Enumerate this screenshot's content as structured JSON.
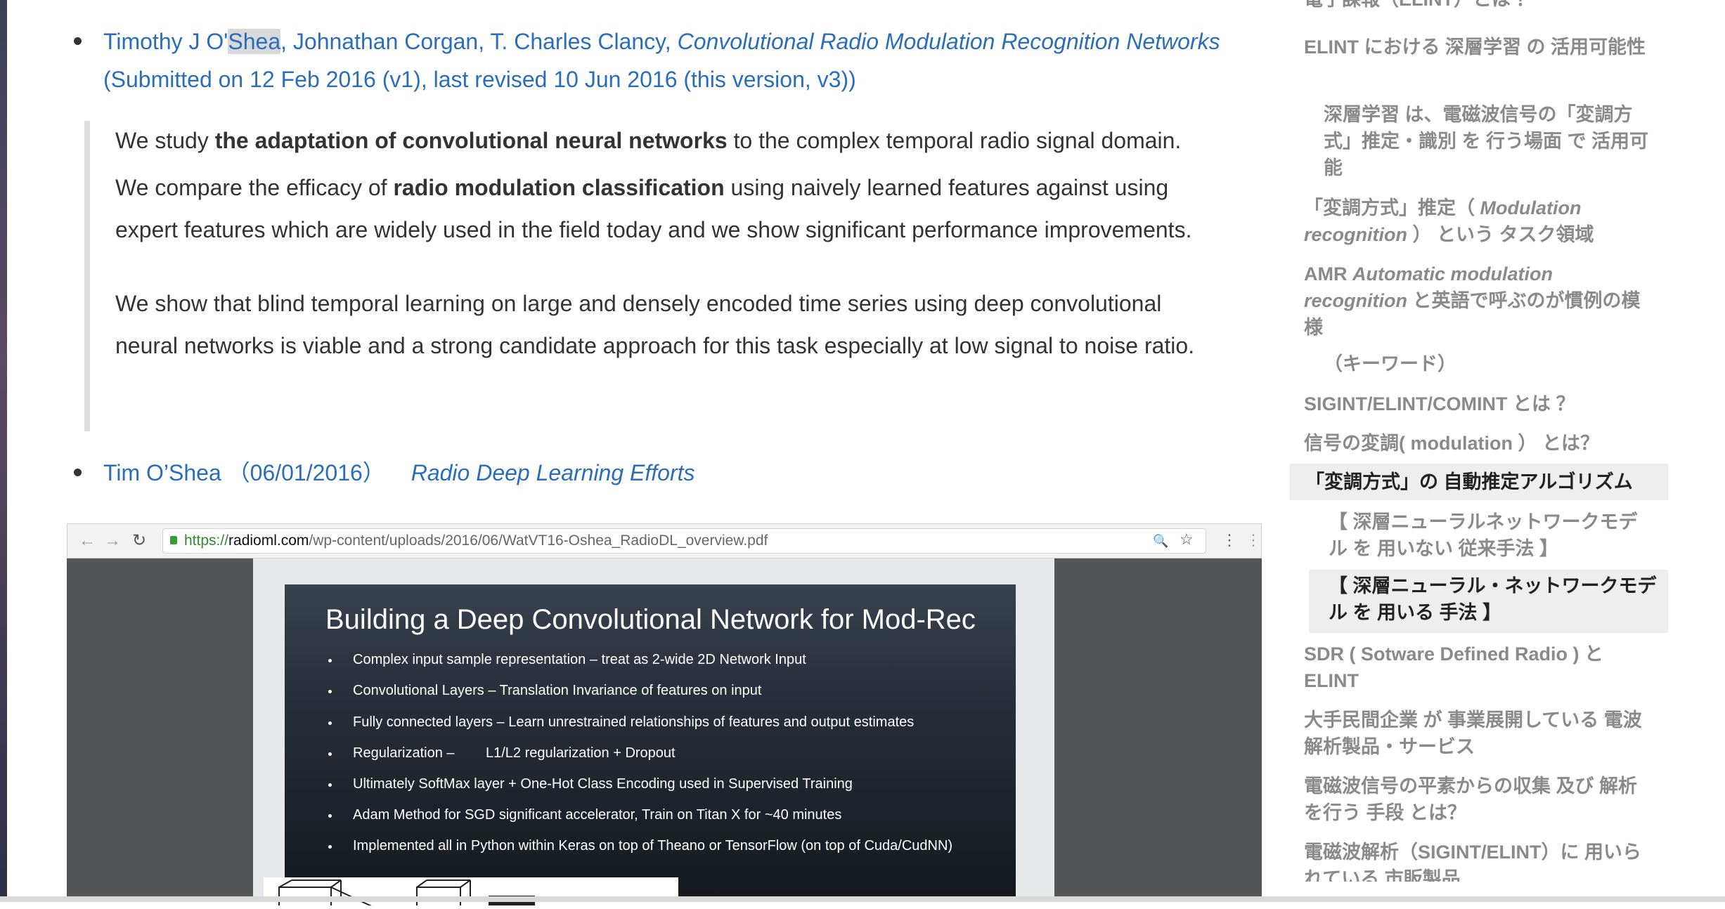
{
  "main": {
    "ref1": {
      "authors_pre": "Timothy J O'",
      "authors_highlight": "Shea",
      "authors_post": ", Johnathan Corgan, T. Charles Clancy, ",
      "title": "Convolutional Radio Modulation Recognition Networks",
      "submitted": "(Submitted on 12 Feb 2016 (v1), last revised 10 Jun 2016 (this version, v3))"
    },
    "quote": {
      "p1_a": "We study ",
      "p1_bold": "the adaptation of convolutional neural networks",
      "p1_b": " to the complex temporal radio signal domain.",
      "p2_a": "We compare the efficacy of ",
      "p2_bold": "radio modulation classification",
      "p2_b": " using naively learned features against using",
      "p2_line2": "expert features which are widely used in the field today and we show significant performance improvements.",
      "p3_line1": "We show that blind temporal learning on large and densely encoded time series using deep convolutional",
      "p3_line2": "neural networks is viable and a strong candidate approach for this task especially at low signal to noise ratio."
    },
    "ref2": {
      "author_date": "Tim O’Shea （06/01/2016）",
      "title": "Radio Deep Learning Efforts"
    }
  },
  "browser": {
    "back": "←",
    "forward": "→",
    "reload": "↻",
    "url_scheme": "https://",
    "url_host": "radioml.com",
    "url_path": "/wp-content/uploads/2016/06/WatVT16-Oshea_RadioDL_overview.pdf",
    "zoom_icon": "🔍",
    "star_icon": "☆",
    "menu_icon": "⋮",
    "slide": {
      "title": "Building a Deep Convolutional Network for Mod-Rec",
      "bullets": [
        "Complex input sample representation – treat as 2-wide 2D Network Input",
        "Convolutional Layers – Translation Invariance of features on input",
        "Fully connected layers – Learn unrestrained relationships of features and output estimates",
        "Regularization –        L1/L2 regularization + Dropout",
        "Ultimately SoftMax layer + One-Hot Class Encoding used in Supervised Training",
        "Adam Method for SGD significant accelerator, Train on Titan X for ~40 minutes",
        "Implemented all in Python within Keras on top of Theano or TensorFlow (on top of Cuda/CudNN)"
      ]
    }
  },
  "toc": {
    "items": [
      {
        "text": "電子課報（ELINT）とは ？"
      },
      {
        "text": "ELINT における 深層学習 の 活用可能性"
      },
      {
        "text": "深層学習 は、電磁波信号の「変調方式」推定・識別 を 行う場面 で 活用可能"
      },
      {
        "pre": "「変調方式」推定（ ",
        "ital": "Modulation recognition",
        "post": " ） という タスク領域"
      },
      {
        "pre": "AMR ",
        "ital": "Automatic modulation recognition",
        "post": " と英語で呼ぶのが慣例の模様"
      },
      {
        "text": "（キーワード）"
      },
      {
        "text": "SIGINT/ELINT/COMINT とは ？"
      },
      {
        "text": "信号の変調( modulation ） とは？"
      },
      {
        "text": "「変調方式」の 自動推定アルゴリズム"
      },
      {
        "text": "【 深層ニューラルネットワークモデル を 用いない 従来手法 】"
      },
      {
        "text": "【 深層ニューラル・ネットワークモデル を 用いる 手法 】"
      },
      {
        "text": "SDR ( Sotware Defined Radio ) と ELINT"
      },
      {
        "text": "大手民間企業 が 事業展開している 電波解析製品・サービス"
      },
      {
        "text": "電磁波信号の平素からの収集 及び 解析 を行う 手段 とは？"
      },
      {
        "text": "電磁波解析（SIGINT/ELINT）に 用いられている 市販製品"
      }
    ]
  }
}
